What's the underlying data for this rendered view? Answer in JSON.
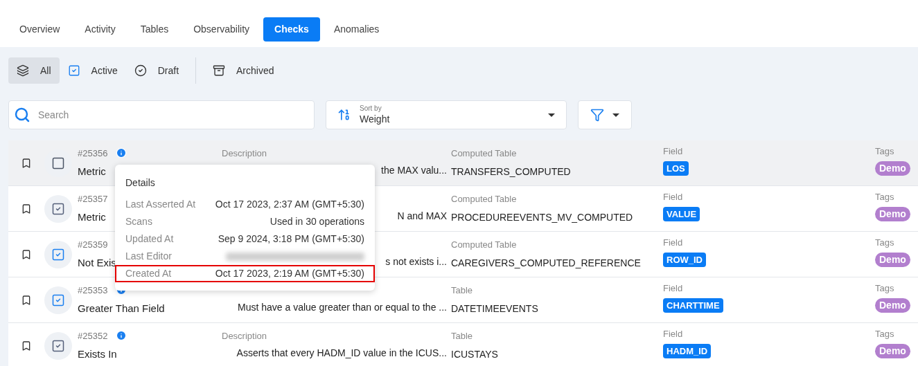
{
  "tabs": [
    {
      "label": "Overview",
      "selected": false
    },
    {
      "label": "Activity",
      "selected": false
    },
    {
      "label": "Tables",
      "selected": false
    },
    {
      "label": "Observability",
      "selected": false
    },
    {
      "label": "Checks",
      "selected": true
    },
    {
      "label": "Anomalies",
      "selected": false
    }
  ],
  "status_filters": [
    {
      "label": "All",
      "selected": true
    },
    {
      "label": "Active",
      "selected": false
    },
    {
      "label": "Draft",
      "selected": false
    },
    {
      "label": "Archived",
      "selected": false
    }
  ],
  "search": {
    "placeholder": "Search"
  },
  "sort": {
    "label": "Sort by",
    "value": "Weight"
  },
  "checks": [
    {
      "id": "#25356",
      "name": "Metric",
      "kind": "empty",
      "highlighted": true,
      "info": true,
      "description_label": "Description",
      "description": "the MAX valu...",
      "table_label": "Computed Table",
      "table": "TRANSFERS_COMPUTED",
      "field_label": "Field",
      "field": "LOS",
      "tags_label": "Tags",
      "tag": "Demo"
    },
    {
      "id": "#25357",
      "name": "Metric",
      "kind": "muted",
      "highlighted": false,
      "info": false,
      "description": "N and MAX",
      "table_label": "Computed Table",
      "table": "PROCEDUREEVENTS_MV_COMPUTED",
      "field_label": "Field",
      "field": "VALUE",
      "tags_label": "Tags",
      "tag": "Demo"
    },
    {
      "id": "#25359",
      "name": "Not Exis",
      "kind": "active",
      "highlighted": false,
      "info": false,
      "description": "s not exists i...",
      "table_label": "Computed Table",
      "table": "CAREGIVERS_COMPUTED_REFERENCE",
      "field_label": "Field",
      "field": "ROW_ID",
      "tags_label": "Tags",
      "tag": "Demo"
    },
    {
      "id": "#25353",
      "name": "Greater Than Field",
      "kind": "active",
      "highlighted": false,
      "info": true,
      "description": "Must have a value greater than or equal to the ...",
      "table_label": "Table",
      "table": "DATETIMEEVENTS",
      "field_label": "Field",
      "field": "CHARTTIME",
      "tags_label": "Tags",
      "tag": "Demo"
    },
    {
      "id": "#25352",
      "name": "Exists In",
      "kind": "muted",
      "highlighted": false,
      "info": true,
      "description_label": "Description",
      "description": "Asserts that every HADM_ID value in the ICUS...",
      "table_label": "Table",
      "table": "ICUSTAYS",
      "field_label": "Field",
      "field": "HADM_ID",
      "tags_label": "Tags",
      "tag": "Demo"
    }
  ],
  "details_popover": {
    "title": "Details",
    "rows": [
      {
        "label": "Last Asserted At",
        "value": "Oct 17 2023, 2:37 AM (GMT+5:30)",
        "highlighted": false
      },
      {
        "label": "Scans",
        "value": "Used in 30 operations",
        "highlighted": false
      },
      {
        "label": "Updated At",
        "value": "Sep 9 2024, 3:18 PM (GMT+5:30)",
        "highlighted": false
      },
      {
        "label": "Last Editor",
        "kind": "redacted",
        "highlighted": false
      },
      {
        "label": "Created At",
        "value": "Oct 17 2023, 2:19 AM (GMT+5:30)",
        "highlighted": true
      }
    ]
  }
}
